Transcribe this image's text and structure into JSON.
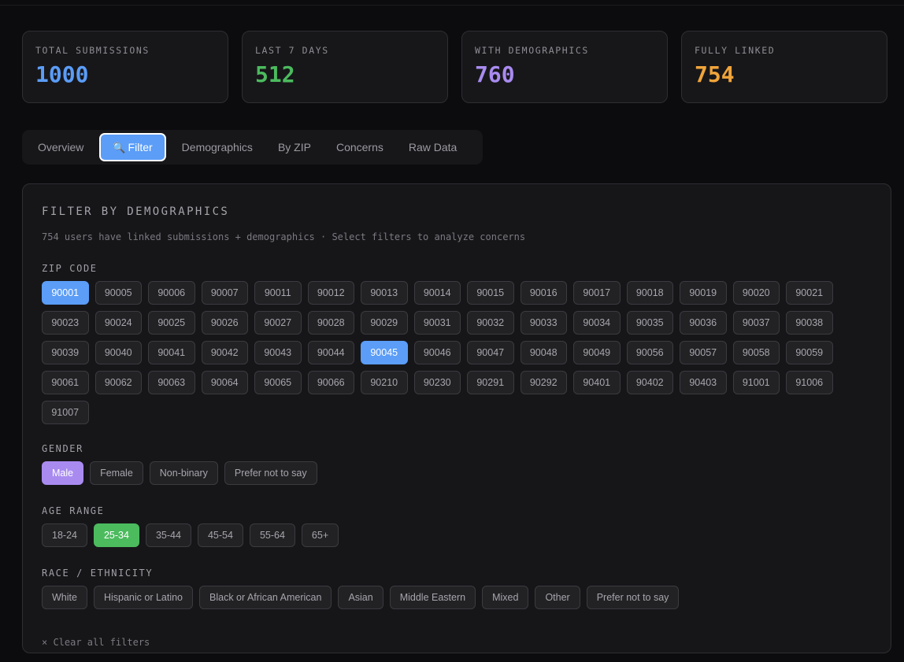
{
  "stats": [
    {
      "label": "TOTAL SUBMISSIONS",
      "value": "1000",
      "color": "#5b9df7"
    },
    {
      "label": "LAST 7 DAYS",
      "value": "512",
      "color": "#4cbb5e"
    },
    {
      "label": "WITH DEMOGRAPHICS",
      "value": "760",
      "color": "#a98bf0"
    },
    {
      "label": "FULLY LINKED",
      "value": "754",
      "color": "#f0a43a"
    }
  ],
  "tabs": [
    {
      "label": "Overview",
      "active": false
    },
    {
      "label": "Filter",
      "icon": "🔍",
      "active": true
    },
    {
      "label": "Demographics",
      "active": false
    },
    {
      "label": "By ZIP",
      "active": false
    },
    {
      "label": "Concerns",
      "active": false
    },
    {
      "label": "Raw Data",
      "active": false
    }
  ],
  "panel": {
    "title": "FILTER BY DEMOGRAPHICS",
    "subtitle": "754 users have linked submissions + demographics · Select filters to analyze concerns"
  },
  "zip": {
    "label": "ZIP CODE",
    "selected": [
      "90001",
      "90045"
    ],
    "options": [
      "90001",
      "90005",
      "90006",
      "90007",
      "90011",
      "90012",
      "90013",
      "90014",
      "90015",
      "90016",
      "90017",
      "90018",
      "90019",
      "90020",
      "90021",
      "90023",
      "90024",
      "90025",
      "90026",
      "90027",
      "90028",
      "90029",
      "90031",
      "90032",
      "90033",
      "90034",
      "90035",
      "90036",
      "90037",
      "90038",
      "90039",
      "90040",
      "90041",
      "90042",
      "90043",
      "90044",
      "90045",
      "90046",
      "90047",
      "90048",
      "90049",
      "90056",
      "90057",
      "90058",
      "90059",
      "90061",
      "90062",
      "90063",
      "90064",
      "90065",
      "90066",
      "90210",
      "90230",
      "90291",
      "90292",
      "90401",
      "90402",
      "90403",
      "91001",
      "91006",
      "91007"
    ]
  },
  "gender": {
    "label": "GENDER",
    "selected": [
      "Male"
    ],
    "options": [
      "Male",
      "Female",
      "Non-binary",
      "Prefer not to say"
    ]
  },
  "age": {
    "label": "AGE RANGE",
    "selected": [
      "25-34"
    ],
    "options": [
      "18-24",
      "25-34",
      "35-44",
      "45-54",
      "55-64",
      "65+"
    ]
  },
  "race": {
    "label": "RACE / ETHNICITY",
    "selected": [],
    "options": [
      "White",
      "Hispanic or Latino",
      "Black or African American",
      "Asian",
      "Middle Eastern",
      "Mixed",
      "Other",
      "Prefer not to say"
    ]
  },
  "clear_label": "× Clear all filters"
}
